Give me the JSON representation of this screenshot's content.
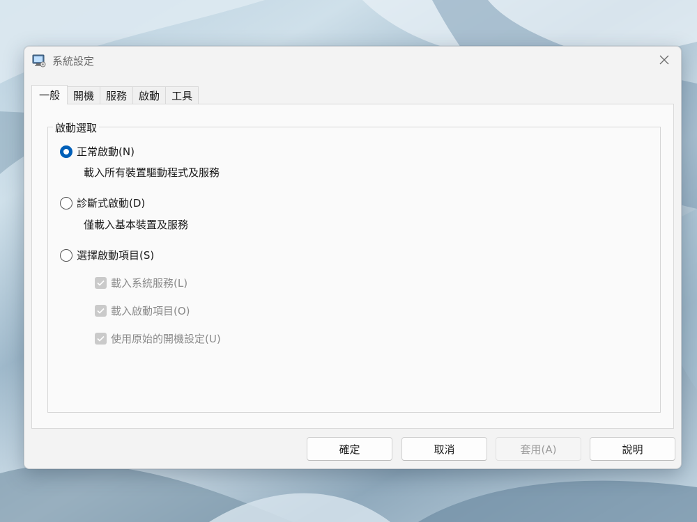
{
  "window": {
    "title": "系統設定"
  },
  "tabs": [
    {
      "label": "一般",
      "active": true
    },
    {
      "label": "開機",
      "active": false
    },
    {
      "label": "服務",
      "active": false
    },
    {
      "label": "啟動",
      "active": false
    },
    {
      "label": "工具",
      "active": false
    }
  ],
  "startup": {
    "group_label": "啟動選取",
    "normal": {
      "label": "正常啟動(N)",
      "description": "載入所有裝置驅動程式及服務",
      "checked": true
    },
    "diagnostic": {
      "label": "診斷式啟動(D)",
      "description": "僅載入基本裝置及服務",
      "checked": false
    },
    "selective": {
      "label": "選擇啟動項目(S)",
      "checked": false,
      "options": [
        {
          "label": "載入系統服務(L)",
          "checked": true,
          "enabled": false
        },
        {
          "label": "載入啟動項目(O)",
          "checked": true,
          "enabled": false
        },
        {
          "label": "使用原始的開機設定(U)",
          "checked": true,
          "enabled": false
        }
      ]
    }
  },
  "buttons": {
    "ok": "確定",
    "cancel": "取消",
    "apply": "套用(A)",
    "help": "說明"
  },
  "colors": {
    "accent": "#005fb8",
    "disabled_text": "#8a8a8a"
  }
}
